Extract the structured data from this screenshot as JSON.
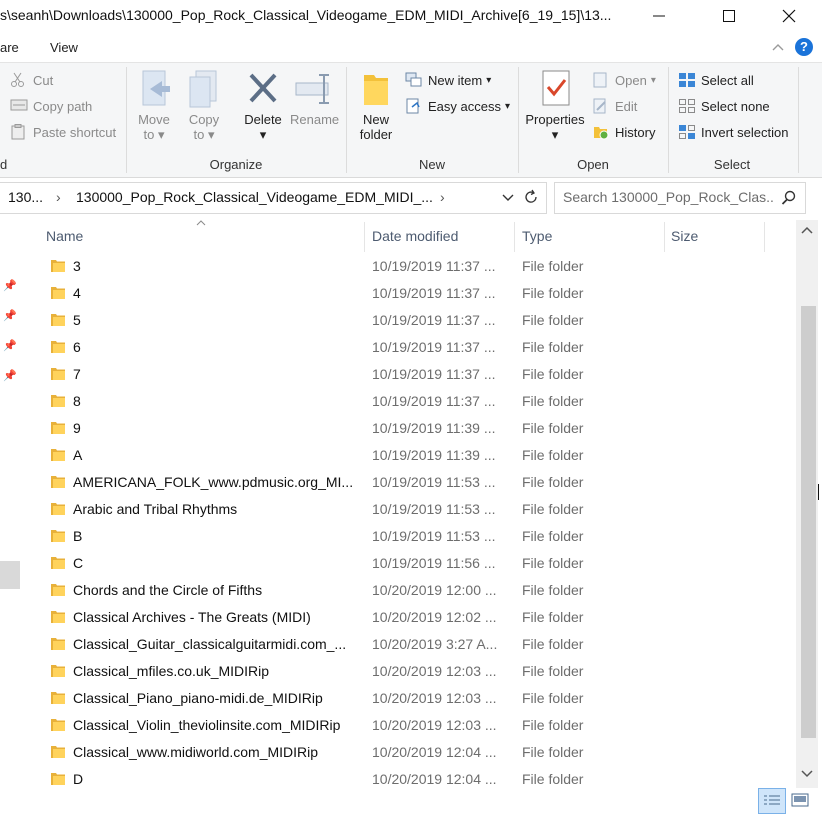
{
  "window": {
    "title": "s\\seanh\\Downloads\\130000_Pop_Rock_Classical_Videogame_EDM_MIDI_Archive[6_19_15]\\13..."
  },
  "menu": {
    "share": "are",
    "view": "View"
  },
  "ribbon": {
    "clipboard": {
      "cut": "Cut",
      "copy_path": "Copy path",
      "paste_shortcut": "Paste shortcut",
      "cut_group_label": "d"
    },
    "organize": {
      "label": "Organize",
      "move_to": [
        "Move",
        "to"
      ],
      "copy_to": [
        "Copy",
        "to"
      ],
      "delete": "Delete",
      "rename": "Rename"
    },
    "new": {
      "label": "New",
      "new_folder": [
        "New",
        "folder"
      ],
      "new_item": "New item",
      "easy_access": "Easy access"
    },
    "open": {
      "label": "Open",
      "properties": "Properties",
      "open": "Open",
      "edit": "Edit",
      "history": "History"
    },
    "select": {
      "label": "Select",
      "select_all": "Select all",
      "select_none": "Select none",
      "invert": "Invert selection"
    }
  },
  "address": {
    "crumb1": "130...",
    "crumb2": "130000_Pop_Rock_Classical_Videogame_EDM_MIDI_..."
  },
  "search": {
    "placeholder": "Search 130000_Pop_Rock_Clas..."
  },
  "columns": {
    "name": "Name",
    "date": "Date modified",
    "type": "Type",
    "size": "Size"
  },
  "files": [
    {
      "name": "3",
      "date": "10/19/2019 11:37 ...",
      "type": "File folder"
    },
    {
      "name": "4",
      "date": "10/19/2019 11:37 ...",
      "type": "File folder"
    },
    {
      "name": "5",
      "date": "10/19/2019 11:37 ...",
      "type": "File folder"
    },
    {
      "name": "6",
      "date": "10/19/2019 11:37 ...",
      "type": "File folder"
    },
    {
      "name": "7",
      "date": "10/19/2019 11:37 ...",
      "type": "File folder"
    },
    {
      "name": "8",
      "date": "10/19/2019 11:37 ...",
      "type": "File folder"
    },
    {
      "name": "9",
      "date": "10/19/2019 11:39 ...",
      "type": "File folder"
    },
    {
      "name": "A",
      "date": "10/19/2019 11:39 ...",
      "type": "File folder"
    },
    {
      "name": "AMERICANA_FOLK_www.pdmusic.org_MI...",
      "date": "10/19/2019 11:53 ...",
      "type": "File folder"
    },
    {
      "name": "Arabic and Tribal Rhythms",
      "date": "10/19/2019 11:53 ...",
      "type": "File folder"
    },
    {
      "name": "B",
      "date": "10/19/2019 11:53 ...",
      "type": "File folder"
    },
    {
      "name": "C",
      "date": "10/19/2019 11:56 ...",
      "type": "File folder"
    },
    {
      "name": "Chords and the Circle of Fifths",
      "date": "10/20/2019 12:00 ...",
      "type": "File folder"
    },
    {
      "name": "Classical Archives - The Greats (MIDI)",
      "date": "10/20/2019 12:02 ...",
      "type": "File folder"
    },
    {
      "name": "Classical_Guitar_classicalguitarmidi.com_...",
      "date": "10/20/2019 3:27 A...",
      "type": "File folder"
    },
    {
      "name": "Classical_mfiles.co.uk_MIDIRip",
      "date": "10/20/2019 12:03 ...",
      "type": "File folder"
    },
    {
      "name": "Classical_Piano_piano-midi.de_MIDIRip",
      "date": "10/20/2019 12:03 ...",
      "type": "File folder"
    },
    {
      "name": "Classical_Violin_theviolinsite.com_MIDIRip",
      "date": "10/20/2019 12:03 ...",
      "type": "File folder"
    },
    {
      "name": "Classical_www.midiworld.com_MIDIRip",
      "date": "10/20/2019 12:04 ...",
      "type": "File folder"
    },
    {
      "name": "D",
      "date": "10/20/2019 12:04 ...",
      "type": "File folder"
    }
  ]
}
